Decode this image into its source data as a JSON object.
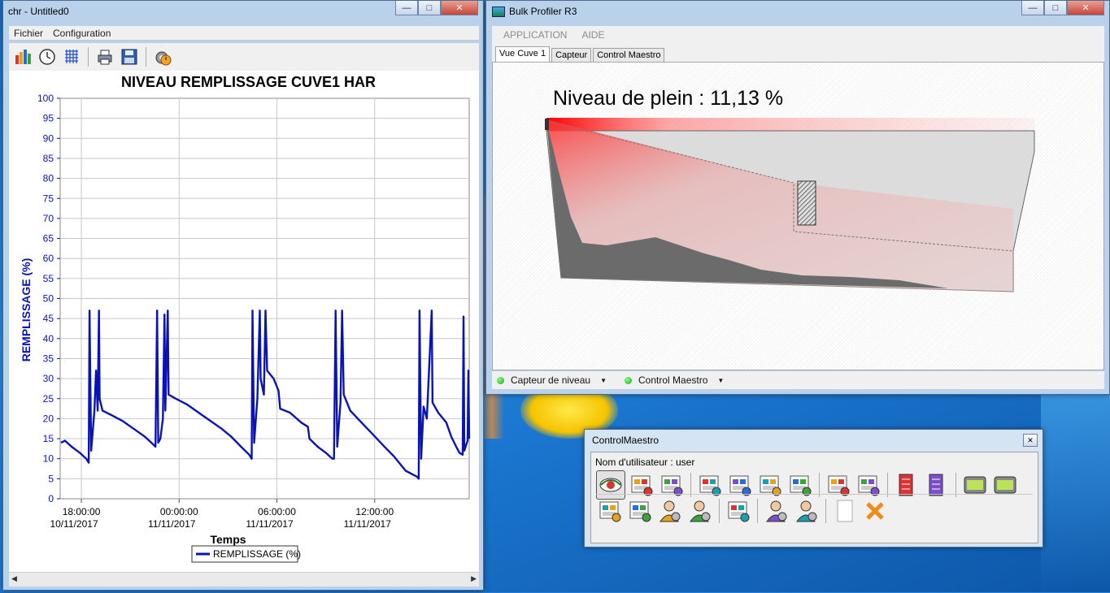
{
  "left_window": {
    "title": "chr - Untitled0",
    "menu": [
      "Fichier",
      "Configuration"
    ],
    "toolbar_icons": [
      "bar-chart-icon",
      "clock-icon",
      "grid-icon",
      "print-icon",
      "save-icon",
      "gear-clock-icon"
    ]
  },
  "chart_data": {
    "type": "line",
    "title": "NIVEAU REMPLISSAGE CUVE1 HAR",
    "xlabel": "Temps",
    "ylabel": "REMPLISSAGE (%)",
    "ylim": [
      0,
      100
    ],
    "yticks": [
      "0",
      "5",
      "10",
      "15",
      "20",
      "25",
      "30",
      "35",
      "40",
      "45",
      "50",
      "55",
      "60",
      "65",
      "70",
      "75",
      "80",
      "85",
      "90",
      "95",
      "100"
    ],
    "xticks": [
      {
        "time": "18:00:00",
        "date": "10/11/2017",
        "hour": 18
      },
      {
        "time": "00:00:00",
        "date": "11/11/2017",
        "hour": 24
      },
      {
        "time": "06:00:00",
        "date": "11/11/2017",
        "hour": 30
      },
      {
        "time": "12:00:00",
        "date": "11/11/2017",
        "hour": 36
      }
    ],
    "xlim_hours": [
      16.7,
      41.8
    ],
    "grid": true,
    "legend_position": "bottom-center",
    "series": [
      {
        "name": "REMPLISSAGE (%)",
        "color": "#0a14b4",
        "points": [
          [
            16.75,
            14
          ],
          [
            17.0,
            14.5
          ],
          [
            17.4,
            13
          ],
          [
            17.9,
            11.5
          ],
          [
            18.3,
            10
          ],
          [
            18.45,
            9
          ],
          [
            18.5,
            47
          ],
          [
            18.6,
            12
          ],
          [
            18.8,
            22
          ],
          [
            18.9,
            32
          ],
          [
            19.0,
            22
          ],
          [
            19.08,
            47
          ],
          [
            19.12,
            25
          ],
          [
            19.3,
            22
          ],
          [
            19.8,
            21
          ],
          [
            20.5,
            19.5
          ],
          [
            21.2,
            17.5
          ],
          [
            21.9,
            15.5
          ],
          [
            22.3,
            14
          ],
          [
            22.55,
            13
          ],
          [
            22.65,
            47
          ],
          [
            22.72,
            14
          ],
          [
            22.85,
            15
          ],
          [
            23.0,
            20
          ],
          [
            23.1,
            46
          ],
          [
            23.15,
            22
          ],
          [
            23.3,
            47
          ],
          [
            23.35,
            26
          ],
          [
            23.8,
            25
          ],
          [
            24.5,
            23.5
          ],
          [
            25.2,
            21.5
          ],
          [
            25.9,
            19.5
          ],
          [
            26.6,
            17.5
          ],
          [
            27.2,
            15.5
          ],
          [
            27.8,
            13
          ],
          [
            28.3,
            11
          ],
          [
            28.45,
            10
          ],
          [
            28.5,
            47
          ],
          [
            28.6,
            14
          ],
          [
            28.8,
            25
          ],
          [
            28.95,
            47
          ],
          [
            29.0,
            30
          ],
          [
            29.2,
            26
          ],
          [
            29.3,
            47
          ],
          [
            29.4,
            32
          ],
          [
            29.8,
            30
          ],
          [
            30.1,
            27
          ],
          [
            30.2,
            22.5
          ],
          [
            30.8,
            21.5
          ],
          [
            31.5,
            19
          ],
          [
            31.9,
            18
          ],
          [
            32.0,
            15
          ],
          [
            32.5,
            13
          ],
          [
            33.0,
            11.5
          ],
          [
            33.4,
            10
          ],
          [
            33.5,
            10
          ],
          [
            33.6,
            47
          ],
          [
            33.7,
            13
          ],
          [
            33.9,
            24
          ],
          [
            34.0,
            47
          ],
          [
            34.1,
            26
          ],
          [
            34.5,
            22
          ],
          [
            35.2,
            19
          ],
          [
            35.9,
            16
          ],
          [
            36.6,
            13
          ],
          [
            37.2,
            10.5
          ],
          [
            37.9,
            7
          ],
          [
            38.6,
            5.5
          ],
          [
            38.7,
            5
          ],
          [
            38.75,
            47
          ],
          [
            38.85,
            10
          ],
          [
            39.0,
            23
          ],
          [
            39.2,
            20
          ],
          [
            39.5,
            47
          ],
          [
            39.55,
            24
          ],
          [
            39.9,
            21.5
          ],
          [
            40.4,
            19
          ],
          [
            40.7,
            15.5
          ],
          [
            41.0,
            13
          ],
          [
            41.2,
            11.5
          ],
          [
            41.4,
            11
          ],
          [
            41.45,
            45.5
          ],
          [
            41.5,
            12
          ],
          [
            41.7,
            14.5
          ],
          [
            41.75,
            32
          ],
          [
            41.8,
            15
          ]
        ]
      }
    ]
  },
  "right_window": {
    "title": "Bulk Profiler R3",
    "menu": [
      "APPLICATION",
      "AIDE"
    ],
    "tabs": [
      "Vue Cuve 1",
      "Capteur",
      "Control Maestro"
    ],
    "active_tab": "Vue Cuve 1",
    "level_text": "Niveau de plein : 11,13 %",
    "fill_level_percent": 11.13,
    "status": [
      {
        "label": "Capteur de niveau",
        "state_color": "#2cb32c"
      },
      {
        "label": "Control Maestro",
        "state_color": "#2cb32c"
      }
    ]
  },
  "maestro_window": {
    "title": "ControlMaestro",
    "user_label": "Nom d'utilisateur : user",
    "row1_icons": [
      "eye-icon",
      "network-grid-icon",
      "network-grid-alt-icon",
      "monitor-chart-icon",
      "alarm-document-icon",
      "trend-chart-icon",
      "print-report-icon",
      "database-refresh-icon",
      "database-save-icon",
      "server-icon",
      "server-alt-icon",
      "lcd-display-icon",
      "lcd-refresh-icon"
    ],
    "row2_icons": [
      "network-warning-icon",
      "tag-grid-icon",
      "user-gear-icon",
      "users-icon",
      "calendar-camera-icon",
      "operator-icon",
      "operator-settings-icon",
      "blank-page-icon",
      "close-x-icon"
    ]
  }
}
